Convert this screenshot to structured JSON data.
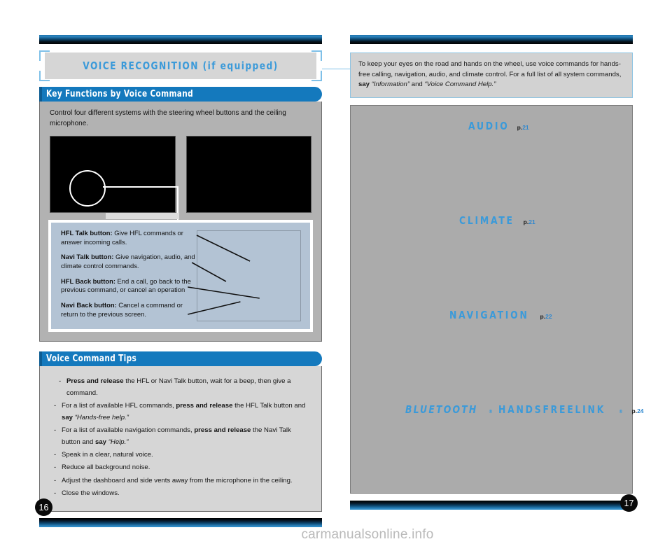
{
  "document": {
    "watermark": "carmanualsonline.info"
  },
  "left_page": {
    "number": "16",
    "title": "VOICE RECOGNITION (if equipped)",
    "key_functions": {
      "heading": "Key Functions by Voice Command",
      "lead": "Control four different systems with the steering wheel buttons and the ceiling microphone.",
      "callouts": [
        {
          "term": "HFL Talk button:",
          "desc": " Give HFL commands or answer incoming calls."
        },
        {
          "term": "Navi Talk button:",
          "desc": " Give navigation, audio, and climate control commands."
        },
        {
          "term": "HFL Back button:",
          "desc": " End a call, go back to the previous command, or cancel an operation"
        },
        {
          "term": "Navi Back button:",
          "desc": " Cancel a command or return to the previous screen."
        }
      ]
    },
    "tips": {
      "heading": "Voice Command Tips",
      "items": [
        "Press and release the HFL or Navi Talk button, wait for a beep, then give a command.",
        "For a list of available HFL commands, press and release the HFL Talk button and say “Hands-free help.”",
        "For a list of available navigation commands, press and release the Navi Talk button and say “Help.”",
        "Speak in a clear, natural voice.",
        "Reduce all background noise.",
        "Adjust the dashboard and side vents away from the microphone in the ceiling.",
        "Close the windows."
      ]
    }
  },
  "right_page": {
    "number": "17",
    "note": "To keep your eyes on the road and hands on the wheel, use voice commands for hands-free calling, navigation, audio, and climate control. For a full list of all system commands, say “Information” and “Voice Command Help.”",
    "systems": [
      {
        "name": "AUDIO",
        "page_prefix": "p.",
        "page": "21"
      },
      {
        "name": "CLIMATE",
        "page_prefix": "p.",
        "page": "21"
      },
      {
        "name": "NAVIGATION",
        "page_prefix": "p.",
        "page": "22"
      },
      {
        "name": "BLUETOOTH",
        "name2": "HANDSFREELINK",
        "mark": "®",
        "page_prefix": "p.",
        "page": "24"
      }
    ]
  },
  "colors": {
    "accent_blue": "#1479bd",
    "light_blue": "#3b9ad9",
    "panel_gray": "#b2b2b2",
    "callout_blue": "#b3c3d4"
  }
}
